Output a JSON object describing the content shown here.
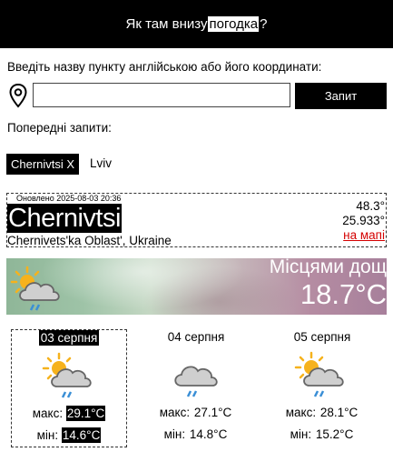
{
  "header": {
    "before": "Як там внизу",
    "highlight": "погодка",
    "after": "?"
  },
  "search": {
    "prompt": "Введіть назву пункту англійською або його координати:",
    "input_value": "",
    "placeholder": "",
    "submit_label": "Запит"
  },
  "history": {
    "label": "Попередні запити:",
    "items": [
      "Chernivtsi X",
      "Lviv"
    ]
  },
  "location": {
    "updated": "Оновлено 2025-08-03 20:36",
    "city": "Chernivtsi",
    "region": "Chernivets'ka Oblast', Ukraine",
    "lat": "48.3°",
    "lon": "25.933°",
    "map_link": "на мапі"
  },
  "current": {
    "description": "Місцями дощ",
    "temperature": "18.7°C",
    "icon": "partly-cloudy-rain-icon"
  },
  "forecast": [
    {
      "day": "03 серпня",
      "max_label": "макс:",
      "max": "29.1°C",
      "min_label": "мін:",
      "min": "14.6°C",
      "icon": "partly-cloudy-rain-icon",
      "selected": true
    },
    {
      "day": "04 серпня",
      "max_label": "макс:",
      "max": "27.1°C",
      "min_label": "мін:",
      "min": "14.8°C",
      "icon": "cloud-rain-icon",
      "selected": false
    },
    {
      "day": "05 серпня",
      "max_label": "макс:",
      "max": "28.1°C",
      "min_label": "мін:",
      "min": "15.2°C",
      "icon": "partly-cloudy-rain-icon",
      "selected": false
    }
  ],
  "colors": {
    "header_bg": "#000000",
    "link": "#d40000",
    "rain": "#3a8fd6",
    "sun": "#f6b21c"
  }
}
